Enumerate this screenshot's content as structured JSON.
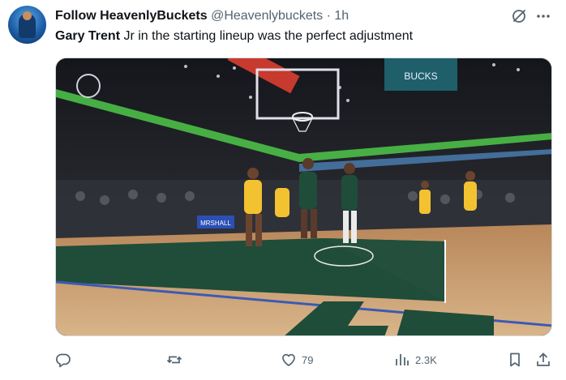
{
  "author": {
    "display_name": "Follow HeavenlyBuckets",
    "handle": "@Heavenlybuckets",
    "separator": "·",
    "time": "1h"
  },
  "tweet": {
    "text_bold": "Gary Trent",
    "text_rest": " Jr in the starting lineup was the perfect adjustment"
  },
  "media": {
    "scoreboard_text": "BUCKS",
    "baseline_sign": "MRSHALL"
  },
  "actions": {
    "reply_count": "",
    "retweet_count": "",
    "like_count": "79",
    "views_count": "2.3K"
  },
  "icons": [
    "reply-icon",
    "retweet-icon",
    "heart-icon",
    "views-icon",
    "bookmark-icon",
    "share-icon",
    "grok-icon",
    "more-icon"
  ],
  "colors": {
    "text": "#0f1419",
    "muted": "#536471",
    "court_green": "#1f4d3a",
    "pacers_gold": "#f2c230"
  }
}
